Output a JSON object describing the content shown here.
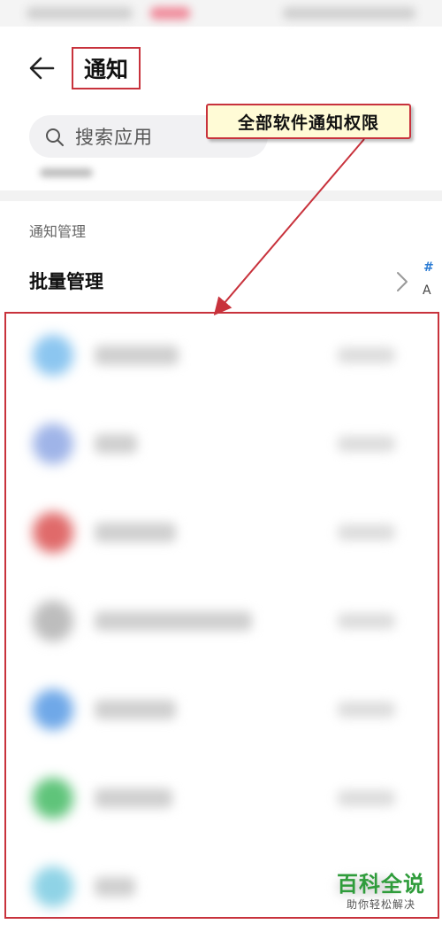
{
  "header": {
    "title": "通知"
  },
  "search": {
    "placeholder": "搜索应用"
  },
  "section": {
    "label": "通知管理"
  },
  "batch": {
    "label": "批量管理"
  },
  "index_bar": {
    "hash": "#",
    "a": "A"
  },
  "annotation": {
    "callout": "全部软件通知权限"
  },
  "app_list": {
    "rows": [
      {
        "icon_color": "#8cc6f0"
      },
      {
        "icon_color": "#9fb4e8"
      },
      {
        "icon_color": "#e06a6a"
      },
      {
        "icon_color": "#bdbdbd"
      },
      {
        "icon_color": "#6fa8e8"
      },
      {
        "icon_color": "#5fc47a"
      },
      {
        "icon_color": "#8fd3e6"
      }
    ]
  },
  "watermark": {
    "title": "百科全说",
    "subtitle": "助你轻松解决"
  },
  "colors": {
    "annotation_red": "#c8323c",
    "callout_bg": "#fffbd6",
    "watermark_green": "#2f9c3b",
    "index_blue": "#2a7bd4"
  }
}
